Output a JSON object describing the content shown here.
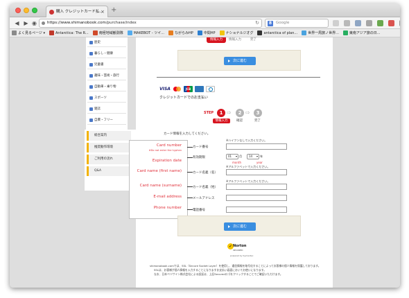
{
  "browser": {
    "tab_title": "購入 クレジットカード払...",
    "url_domain": "https://www.shimanobook.com",
    "url_path": "/purchase/index",
    "search_placeholder": "Google",
    "bookmarks": [
      {
        "label": "よく見るページ ▾",
        "color": "#8a8a8a"
      },
      {
        "label": "Antarctica: The R...",
        "color": "#c0392b"
      },
      {
        "label": "南極地域観測隊",
        "color": "#d04a2a"
      },
      {
        "label": "MAKEBOT - ツイ...",
        "color": "#55acee"
      },
      {
        "label": "ながらみHP",
        "color": "#e67e22"
      },
      {
        "label": "中間HP",
        "color": "#2c7fd0"
      },
      {
        "label": "ナショナルジオグ",
        "color": "#f1c40f"
      },
      {
        "label": "antarctica of plan...",
        "color": "#333333"
      },
      {
        "label": "世界一周旅ノ世界...",
        "color": "#4aa3df"
      },
      {
        "label": "東南アジア旅の日...",
        "color": "#27ae60"
      }
    ]
  },
  "sidebar": {
    "categories": [
      "歴史",
      "暮らし・健康",
      "児童書",
      "趣味・芸術・旅行",
      "自動車・乗り物",
      "スポーツ",
      "雑誌",
      "自費・フリー"
    ],
    "guide": [
      "総合案内",
      "推奨動作環境",
      "ご利用の流れ",
      "Q&A"
    ]
  },
  "header": {
    "tab_left": "情報入力",
    "tab_active": "情報入力",
    "tab_right": "完了"
  },
  "next_button": "次に進む",
  "payment": {
    "card_brands": [
      "VISA",
      "MasterCard",
      "JCB",
      "AMEX",
      "Diners"
    ],
    "title": "クレジットカードでのお支払い"
  },
  "steps": {
    "label": "STEP",
    "numbers": [
      "1",
      "2",
      "3"
    ],
    "names": [
      "情報入力",
      "確認",
      "完了"
    ]
  },
  "form": {
    "intro": "カード情報を入力してください。",
    "card_number": {
      "label": "カード番号",
      "hint": "※ハイフンなしで入力ください。"
    },
    "expiry": {
      "label": "有効期限",
      "month_value": "01",
      "month_unit": "月",
      "year_value": "14",
      "year_unit": "年"
    },
    "name_first": {
      "label": "カード名義（名）",
      "hint": "※アルファベットで入力ください。"
    },
    "name_last": {
      "label": "カード名義（姓）",
      "hint": "※アルファベットで入力ください。"
    },
    "email": {
      "label": "メールアドレス"
    },
    "phone": {
      "label": "電話番号"
    }
  },
  "callout": {
    "card_number": "Card number",
    "card_number_note": "※Do not enter the hyphen",
    "expiration": "Expiration date",
    "first_name": "Card name (first name)",
    "surname": "Card name (surname)",
    "email": "E-mail address",
    "phone": "Phone number",
    "month": "month",
    "year": "year"
  },
  "norton": {
    "brand": "Norton",
    "secured": "SECURED",
    "by": "powered by Symantec"
  },
  "footer": [
    "shimanobook.comでは、SSL（Secure Socket Layer）を使用し、通信情報を暗号化することによってお客様の個人情報を保護しております。",
    "SSLは、お客様が個人情報を入力することになりますお支払い画面においてお使いになります。",
    "なお、日本ベリサイン株式会社による認証は、上記Securedロゴをクリックすることでご確認いただけます。"
  ]
}
